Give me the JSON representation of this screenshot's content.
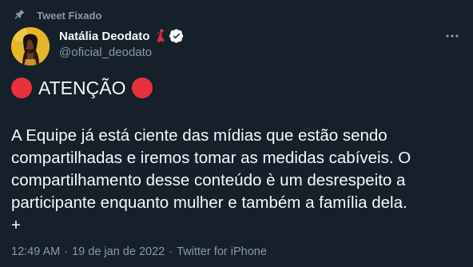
{
  "pinned": {
    "label": "Tweet Fixado",
    "icon": "pin-icon"
  },
  "author": {
    "display_name": "Natália Deodato",
    "handle": "@oficial_deodato",
    "name_emoji": "dancer-emoji",
    "verified_icon": "verified-badge-icon",
    "avatar": "profile-photo"
  },
  "menu": {
    "icon": "more-options-icon"
  },
  "tweet": {
    "headline": "ATENÇÃO",
    "headline_emoji": "red-circle-emoji",
    "body": "A Equipe já está ciente das mídias que estão sendo\ncompartilhadas e iremos tomar as medidas cabíveis. O\ncompartilhamento desse conteúdo è um desrespeito a\nparticipante enquanto mulher e também a família dela.\n+"
  },
  "meta": {
    "time": "12:49 AM",
    "separator_1": "·",
    "date": "19 de jan de 2022",
    "separator_2": "·",
    "source": "Twitter for iPhone"
  },
  "colors": {
    "background": "#15202b",
    "text_primary": "#f7f9f9",
    "text_secondary": "#8b98a5",
    "verified": "#ffffff",
    "red_circle": "#e8303f"
  }
}
